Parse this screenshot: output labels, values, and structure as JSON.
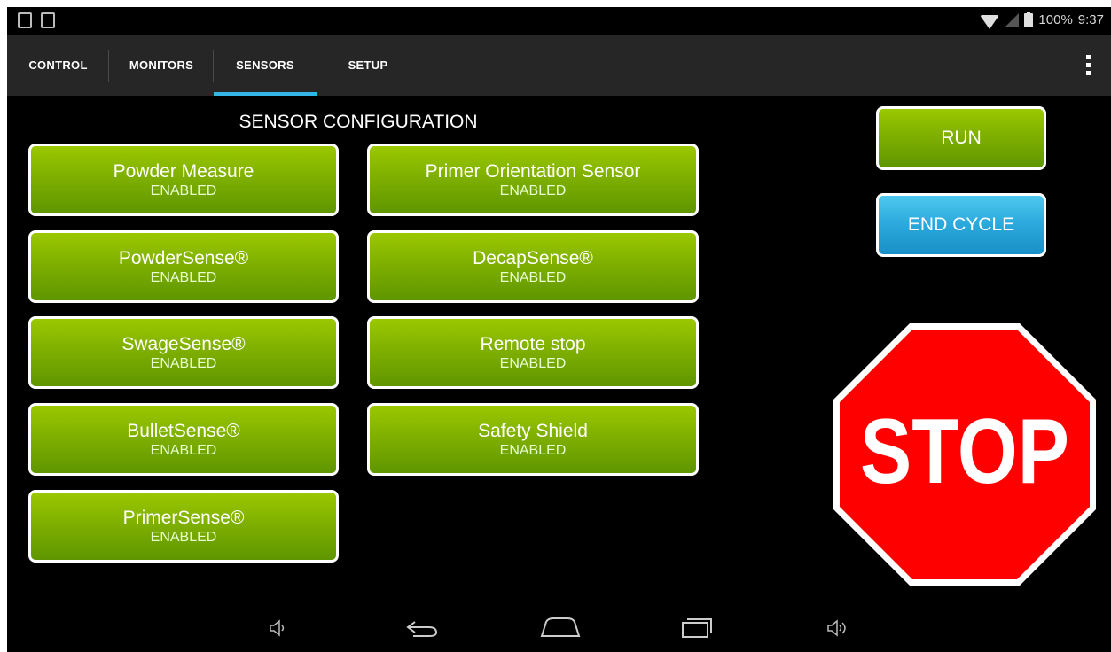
{
  "status_bar": {
    "left_icons": [
      "usb-icon",
      "image-icon"
    ],
    "battery_percent": "100%",
    "time": "9:37"
  },
  "tabs": [
    {
      "label": "CONTROL",
      "active": false
    },
    {
      "label": "MONITORS",
      "active": false
    },
    {
      "label": "SENSORS",
      "active": true
    },
    {
      "label": "SETUP",
      "active": false
    }
  ],
  "main": {
    "title": "SENSOR CONFIGURATION",
    "sensors": [
      {
        "name": "Powder Measure",
        "state": "ENABLED"
      },
      {
        "name": "PowderSense®",
        "state": "ENABLED"
      },
      {
        "name": "SwageSense®",
        "state": "ENABLED"
      },
      {
        "name": "BulletSense®",
        "state": "ENABLED"
      },
      {
        "name": "PrimerSense®",
        "state": "ENABLED"
      },
      {
        "name": "Primer Orientation Sensor",
        "state": "ENABLED"
      },
      {
        "name": "DecapSense®",
        "state": "ENABLED"
      },
      {
        "name": "Remote stop",
        "state": "ENABLED"
      },
      {
        "name": "Safety Shield",
        "state": "ENABLED"
      }
    ]
  },
  "controls": {
    "run_label": "RUN",
    "end_cycle_label": "END CYCLE",
    "stop_label": "STOP"
  },
  "colors": {
    "enabled_green": "#7fb000",
    "end_cycle_blue": "#2aa8dc",
    "tab_indicator": "#33b5e5",
    "stop_red": "#ff0000"
  },
  "navigation_bar": [
    "volume-down-icon",
    "back-icon",
    "home-icon",
    "recent-apps-icon",
    "volume-up-icon"
  ]
}
